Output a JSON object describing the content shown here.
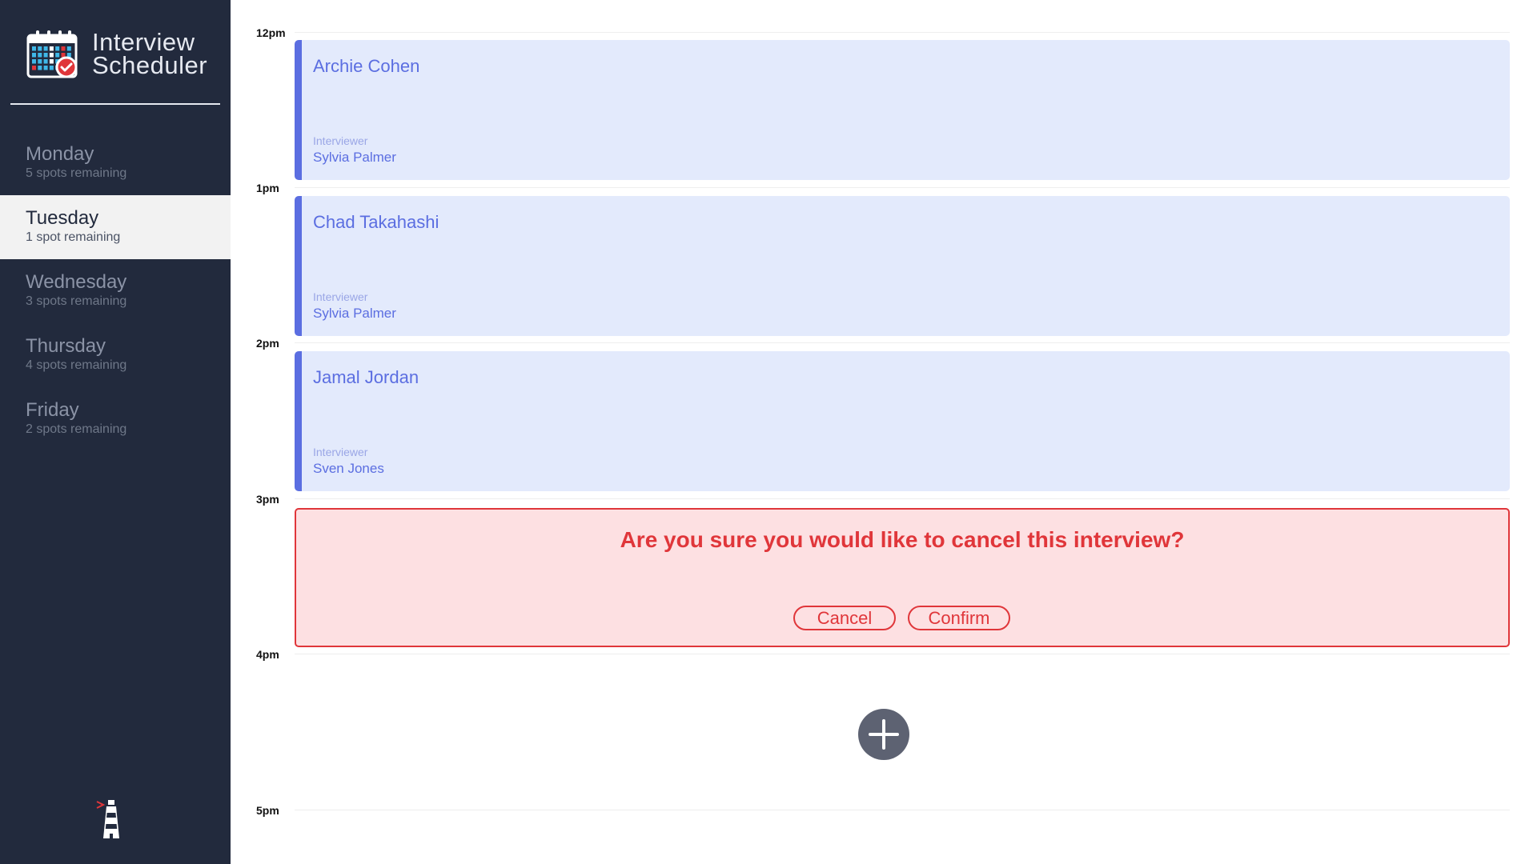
{
  "brand": {
    "line1": "Interview",
    "line2": "Scheduler",
    "logo_icon": "calendar-check-icon"
  },
  "days": [
    {
      "name": "Monday",
      "spots": "5 spots remaining",
      "selected": false
    },
    {
      "name": "Tuesday",
      "spots": "1 spot remaining",
      "selected": true
    },
    {
      "name": "Wednesday",
      "spots": "3 spots remaining",
      "selected": false
    },
    {
      "name": "Thursday",
      "spots": "4 spots remaining",
      "selected": false
    },
    {
      "name": "Friday",
      "spots": "2 spots remaining",
      "selected": false
    }
  ],
  "footer_icon": "lighthouse-icon",
  "times": [
    "12pm",
    "1pm",
    "2pm",
    "3pm",
    "4pm",
    "5pm"
  ],
  "appointments": [
    {
      "student": "Archie Cohen",
      "label": "Interviewer",
      "interviewer": "Sylvia Palmer"
    },
    {
      "student": "Chad Takahashi",
      "label": "Interviewer",
      "interviewer": "Sylvia Palmer"
    },
    {
      "student": "Jamal Jordan",
      "label": "Interviewer",
      "interviewer": "Sven Jones"
    }
  ],
  "confirm": {
    "message": "Are you sure you would like to cancel this interview?",
    "cancel_label": "Cancel",
    "confirm_label": "Confirm"
  },
  "add_icon": "plus-icon",
  "colors": {
    "sidebar": "#222a3d",
    "accent": "#5b6ee1",
    "appointment_bg": "#e3eafc",
    "danger": "#e0363a",
    "danger_bg": "#fde0e2"
  }
}
